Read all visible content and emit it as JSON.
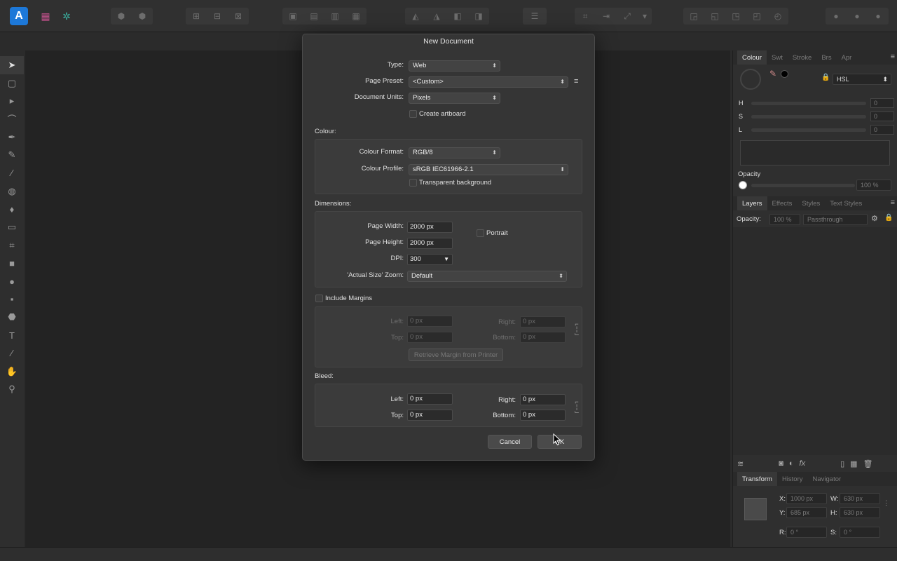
{
  "dialog": {
    "title": "New Document",
    "type_label": "Type:",
    "type_value": "Web",
    "preset_label": "Page Preset:",
    "preset_value": "<Custom>",
    "units_label": "Document Units:",
    "units_value": "Pixels",
    "create_artboard": "Create artboard",
    "colour_section": "Colour:",
    "colour_format_label": "Colour Format:",
    "colour_format_value": "RGB/8",
    "colour_profile_label": "Colour Profile:",
    "colour_profile_value": "sRGB IEC61966-2.1",
    "transparent_bg": "Transparent background",
    "dimensions_section": "Dimensions:",
    "page_width_label": "Page Width:",
    "page_width_value": "2000 px",
    "page_height_label": "Page Height:",
    "page_height_value": "2000 px",
    "portrait": "Portrait",
    "dpi_label": "DPI:",
    "dpi_value": "300",
    "zoom_label": "'Actual Size' Zoom:",
    "zoom_value": "Default",
    "include_margins": "Include Margins",
    "margins": {
      "left_label": "Left:",
      "left_value": "0 px",
      "right_label": "Right:",
      "right_value": "0 px",
      "top_label": "Top:",
      "top_value": "0 px",
      "bottom_label": "Bottom:",
      "bottom_value": "0 px",
      "retrieve_button": "Retrieve Margin from Printer"
    },
    "bleed_section": "Bleed:",
    "bleed": {
      "left_label": "Left:",
      "left_value": "0 px",
      "right_label": "Right:",
      "right_value": "0 px",
      "top_label": "Top:",
      "top_value": "0 px",
      "bottom_label": "Bottom:",
      "bottom_value": "0 px"
    },
    "cancel_button": "Cancel",
    "ok_button": "OK"
  },
  "colour_panel": {
    "tabs": [
      "Colour",
      "Swt",
      "Stroke",
      "Brs",
      "Apr"
    ],
    "model": "HSL",
    "h_label": "H",
    "h_value": "0",
    "s_label": "S",
    "s_value": "0",
    "l_label": "L",
    "l_value": "0",
    "opacity_label": "Opacity",
    "opacity_value": "100 %"
  },
  "layers_panel": {
    "tabs": [
      "Layers",
      "Effects",
      "Styles",
      "Text Styles"
    ],
    "opacity_label": "Opacity:",
    "opacity_value": "100 %",
    "blend_mode": "Passthrough"
  },
  "transform_panel": {
    "tabs": [
      "Transform",
      "History",
      "Navigator"
    ],
    "x_label": "X:",
    "x_value": "1000 px",
    "y_label": "Y:",
    "y_value": "685 px",
    "w_label": "W:",
    "w_value": "630 px",
    "h_label": "H:",
    "h_value": "630 px",
    "r_label": "R:",
    "r_value": "0 °",
    "s_label": "S:",
    "s_value": "0 °"
  },
  "colors": {
    "accent": "#1d78d8",
    "background": "#2b2b2b",
    "dialog": "#353535"
  }
}
